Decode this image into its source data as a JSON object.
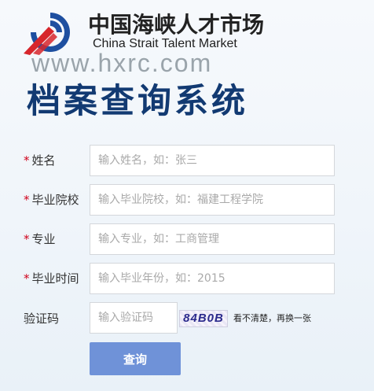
{
  "header": {
    "brand_cn": "中国海峡人才市场",
    "brand_en": "China Strait Talent Market",
    "url": "www.hxrc.com",
    "system_title": "档案查询系统"
  },
  "form": {
    "required_mark": "*",
    "name": {
      "label": "姓名",
      "placeholder": "输入姓名，如：张三",
      "value": ""
    },
    "school": {
      "label": "毕业院校",
      "placeholder": "输入毕业院校，如：福建工程学院",
      "value": ""
    },
    "major": {
      "label": "专业",
      "placeholder": "输入专业，如：工商管理",
      "value": ""
    },
    "grad_time": {
      "label": "毕业时间",
      "placeholder": "输入毕业年份，如：2015",
      "value": ""
    },
    "captcha": {
      "label": "验证码",
      "placeholder": "输入验证码",
      "value": "",
      "image_text": "84B0B",
      "refresh_text": "看不清楚，再换一张"
    },
    "submit_label": "查询"
  },
  "colors": {
    "title": "#123a72",
    "required": "#d0021b",
    "button": "#6f92d8",
    "logo_blue": "#1e4fa0",
    "logo_red": "#d7262c"
  },
  "icons": {
    "logo": "strait-talent-logo-icon"
  }
}
